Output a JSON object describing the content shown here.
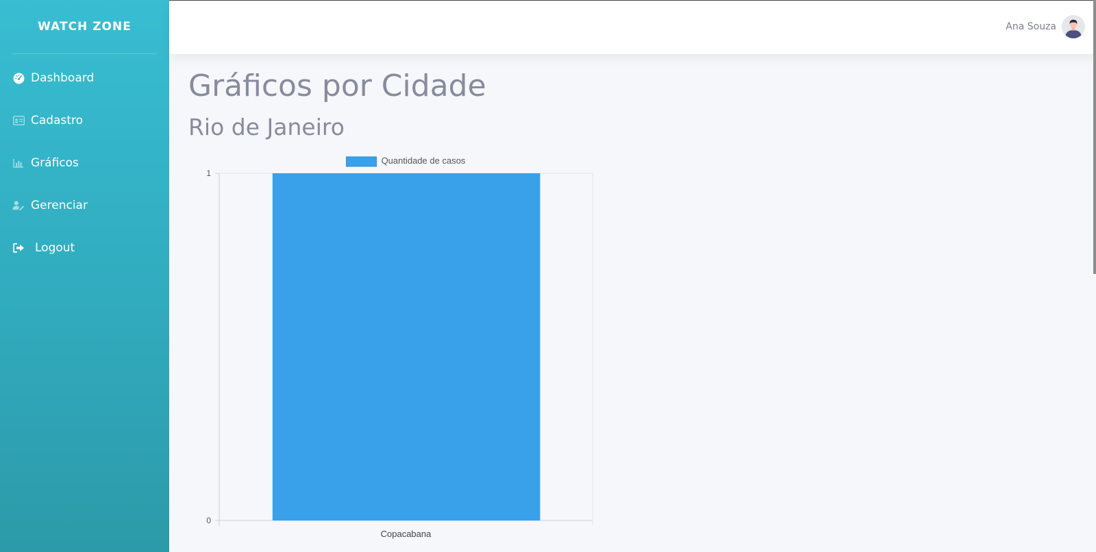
{
  "brand": "WATCH ZONE",
  "sidebar": {
    "items": [
      {
        "label": "Dashboard",
        "icon": "dashboard-gauge-icon"
      },
      {
        "label": "Cadastro",
        "icon": "id-card-icon"
      },
      {
        "label": "Gráficos",
        "icon": "bar-chart-icon"
      },
      {
        "label": "Gerenciar",
        "icon": "user-edit-icon"
      },
      {
        "label": "Logout",
        "icon": "sign-out-icon"
      }
    ]
  },
  "header": {
    "user_name": "Ana Souza",
    "avatar_icon": "user-avatar-icon"
  },
  "page": {
    "title": "Gráficos por Cidade",
    "city": "Rio de Janeiro"
  },
  "colors": {
    "sidebar_top": "#38bdd2",
    "sidebar_bottom": "#2c9aa9",
    "bar": "#38a1ea",
    "heading": "#878b9c"
  },
  "chart_data": {
    "type": "bar",
    "categories": [
      "Copacabana"
    ],
    "series": [
      {
        "name": "Quantidade de casos",
        "values": [
          1
        ]
      }
    ],
    "ylim": [
      0,
      1
    ],
    "yticks": [
      "0",
      "1"
    ],
    "legend": "top",
    "grid": false
  }
}
